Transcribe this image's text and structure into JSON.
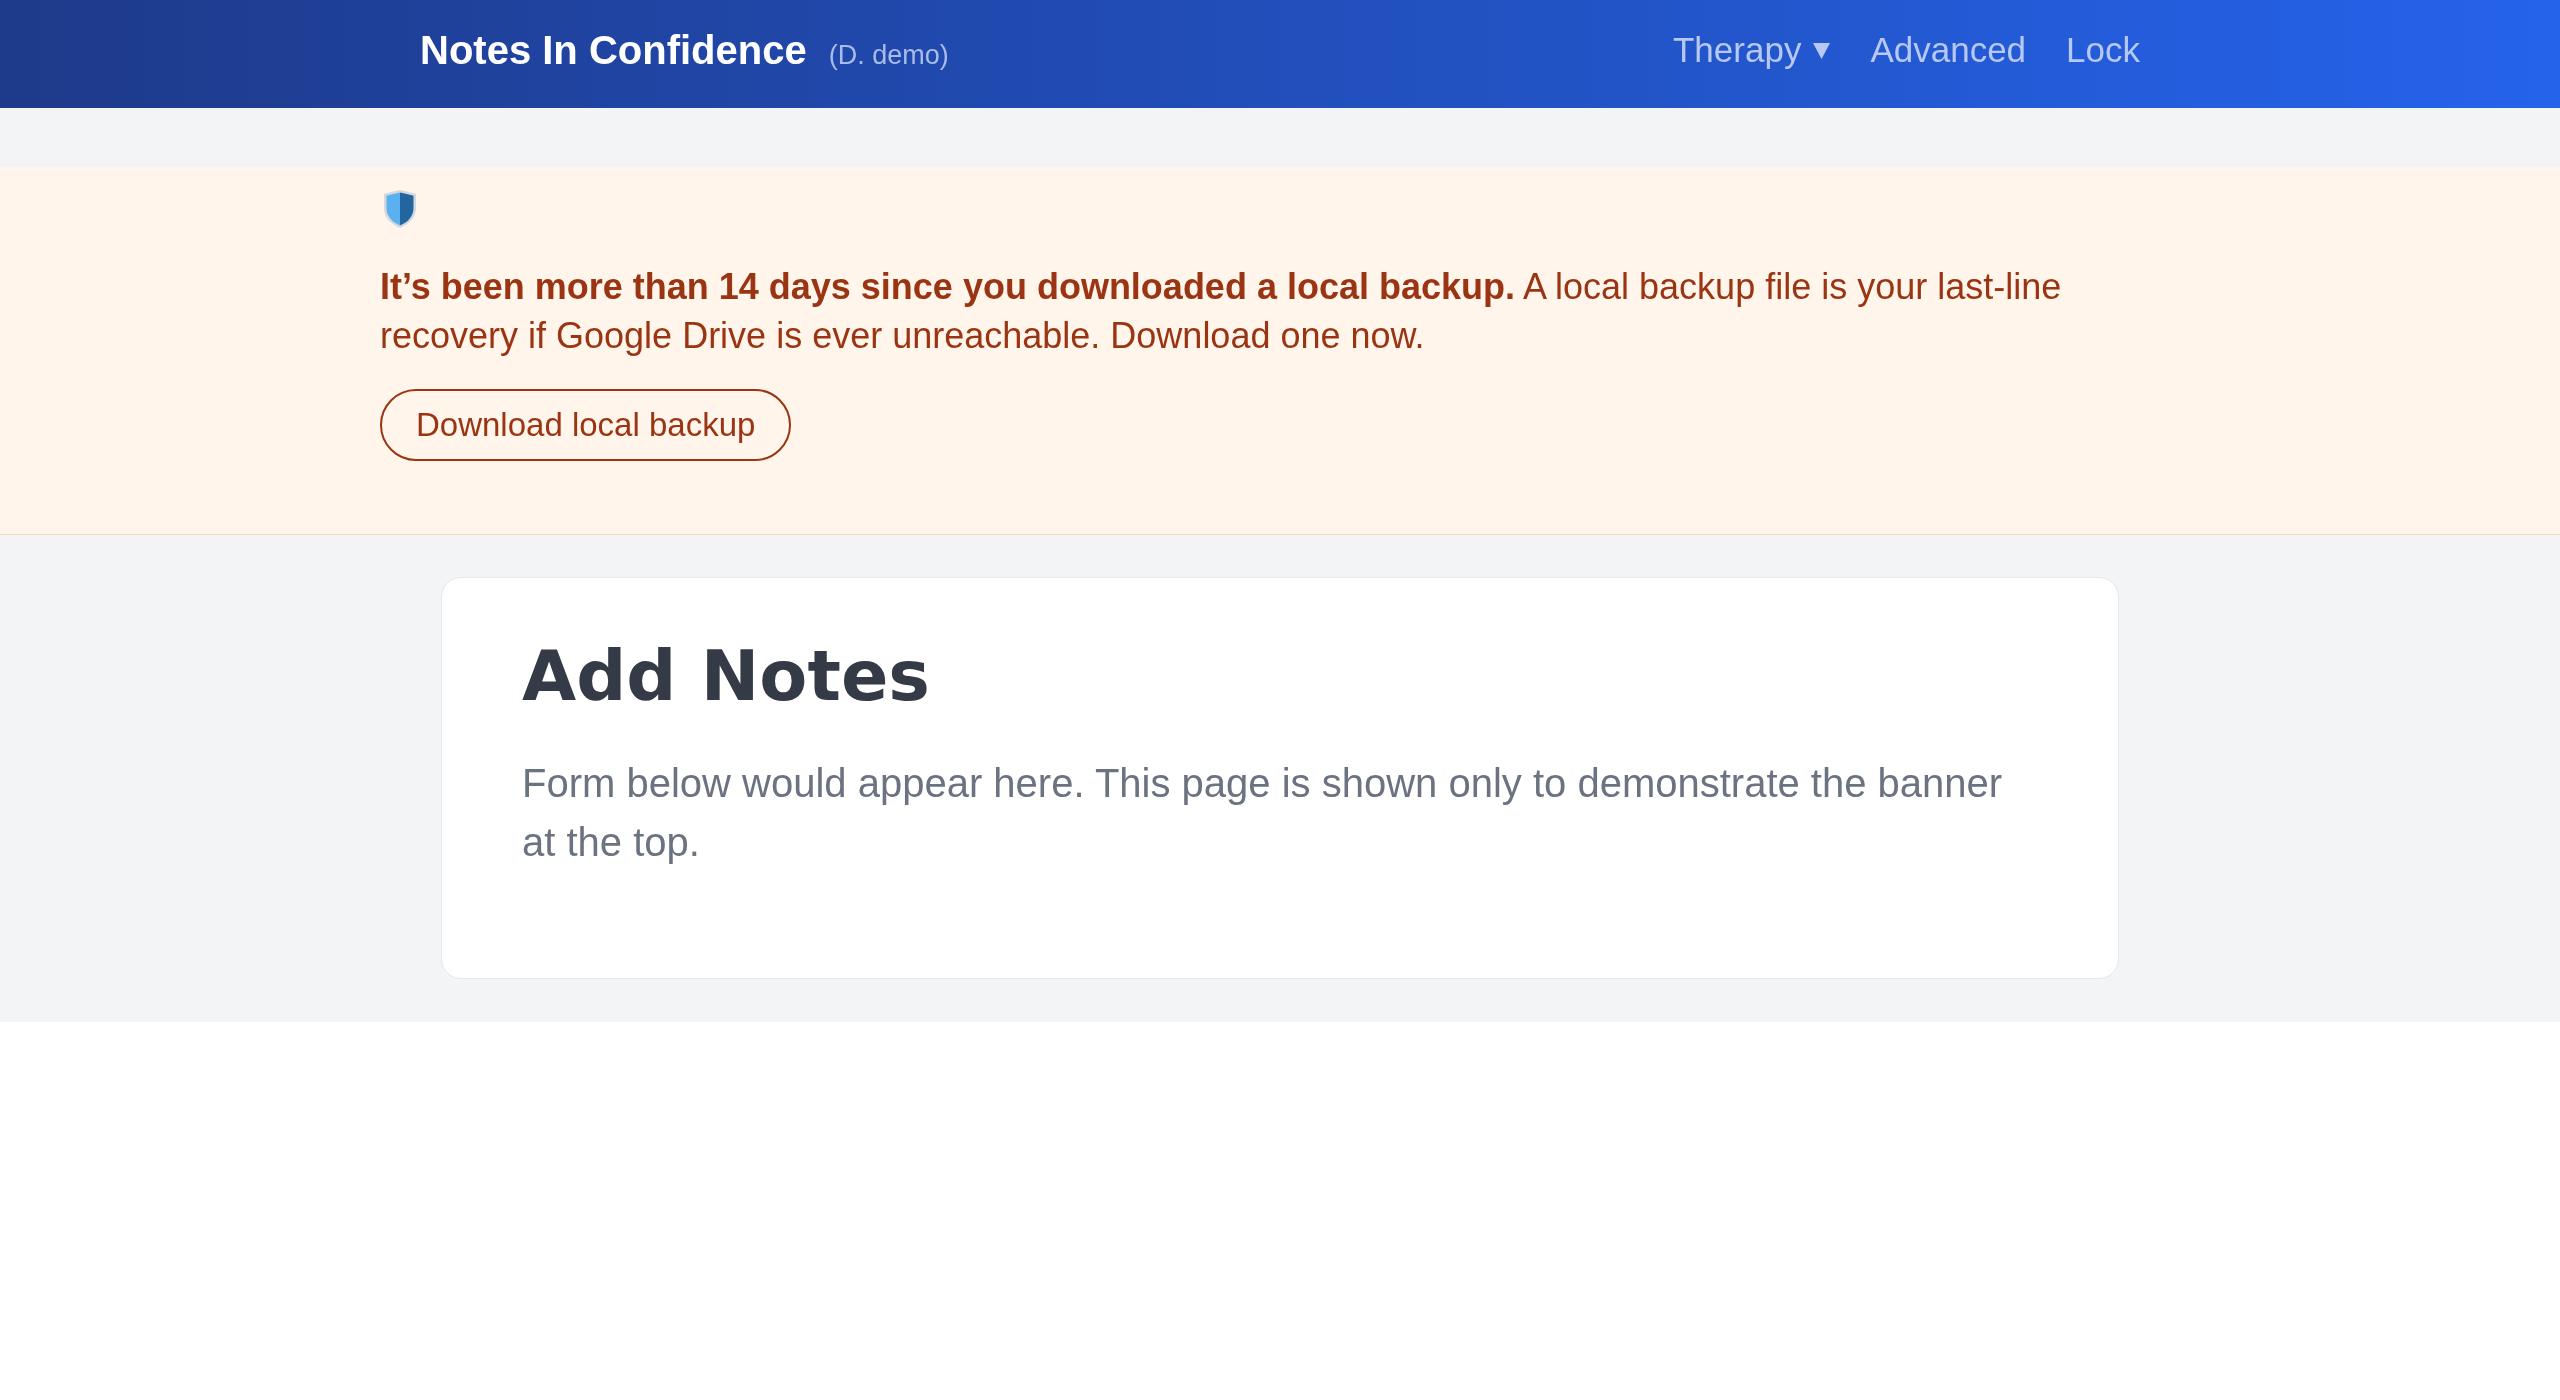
{
  "header": {
    "brand": "Notes In Confidence",
    "user": "(D. demo)",
    "nav": [
      {
        "kind": "dropdown",
        "label": "Therapy"
      },
      {
        "kind": "link",
        "label": "Advanced"
      },
      {
        "kind": "link",
        "label": "Lock"
      }
    ]
  },
  "banner": {
    "message": "**It’s been more than 14 days since you downloaded a local backup.** A local backup file is your last-line recovery if Google Drive is ever unreachable. Download one now.",
    "button": "Download local backup"
  },
  "card": {
    "title": "Add Notes",
    "text": "Form below would appear here. This page is shown only to demonstrate the banner at the top."
  }
}
